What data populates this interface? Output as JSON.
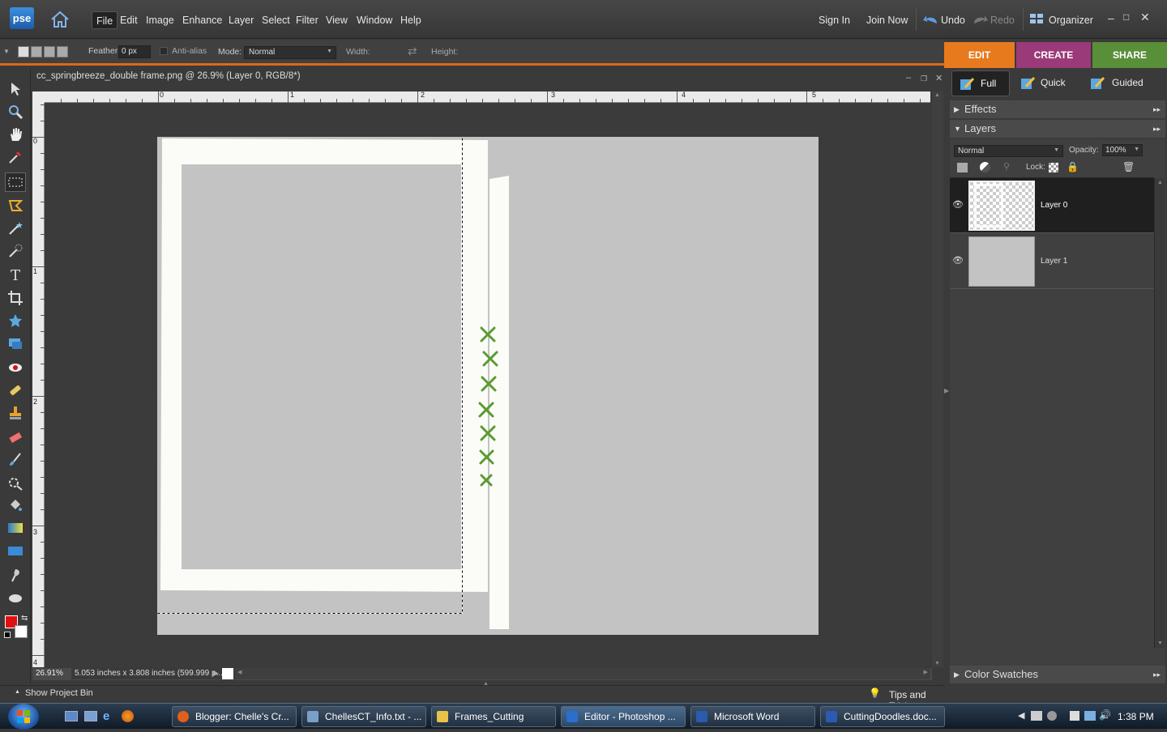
{
  "app": {
    "logo": "pse"
  },
  "menu": [
    "File",
    "Edit",
    "Image",
    "Enhance",
    "Layer",
    "Select",
    "Filter",
    "View",
    "Window",
    "Help"
  ],
  "toplinks": {
    "sign_in": "Sign In",
    "join_now": "Join Now",
    "undo": "Undo",
    "redo": "Redo",
    "organizer": "Organizer"
  },
  "options": {
    "feather_label": "Feather:",
    "feather_value": "0 px",
    "antialias_label": "Anti-alias",
    "mode_label": "Mode:",
    "mode_value": "Normal",
    "width_label": "Width:",
    "height_label": "Height:"
  },
  "tabs": [
    {
      "label": "EDIT",
      "color": "#e87a1e"
    },
    {
      "label": "CREATE",
      "color": "#9b3a78"
    },
    {
      "label": "SHARE",
      "color": "#5a8f3a"
    }
  ],
  "edit_modes": [
    "Full",
    "Quick",
    "Guided"
  ],
  "document": {
    "title": "cc_springbreeze_double frame.png @ 26.9% (Layer 0, RGB/8*)",
    "zoom": "26.91%",
    "info": "5.053 inches x 3.808 inches (599.999 p..."
  },
  "ruler": {
    "h": [
      "0",
      "1",
      "2",
      "3",
      "4",
      "5"
    ],
    "v": [
      "0",
      "1",
      "2",
      "3",
      "4"
    ]
  },
  "panels": {
    "effects": "Effects",
    "layers": "Layers",
    "blend_mode": "Normal",
    "opacity_label": "Opacity:",
    "opacity_value": "100%",
    "lock_label": "Lock:",
    "color_swatches": "Color Swatches"
  },
  "layers": [
    {
      "name": "Layer 0",
      "selected": true
    },
    {
      "name": "Layer 1",
      "selected": false
    }
  ],
  "bottom": {
    "project_bin": "Show Project Bin",
    "tips": "Tips and Tricks"
  },
  "taskbar": {
    "items": [
      {
        "label": "Blogger: Chelle's Cr...",
        "color": "#e0601a"
      },
      {
        "label": "ChellesCT_Info.txt - ...",
        "color": "#7aa0c8"
      },
      {
        "label": "Frames_Cutting",
        "color": "#e8c34a"
      },
      {
        "label": "Editor - Photoshop ...",
        "color": "#2a6fcf",
        "active": true
      },
      {
        "label": "Microsoft Word",
        "color": "#2a5bb0"
      },
      {
        "label": "CuttingDoodles.doc...",
        "color": "#2a5bb0"
      }
    ],
    "clock": "1:38 PM"
  },
  "colors": {
    "foreground": "#e01010",
    "background": "#ffffff",
    "accent": "#d96a1a"
  }
}
